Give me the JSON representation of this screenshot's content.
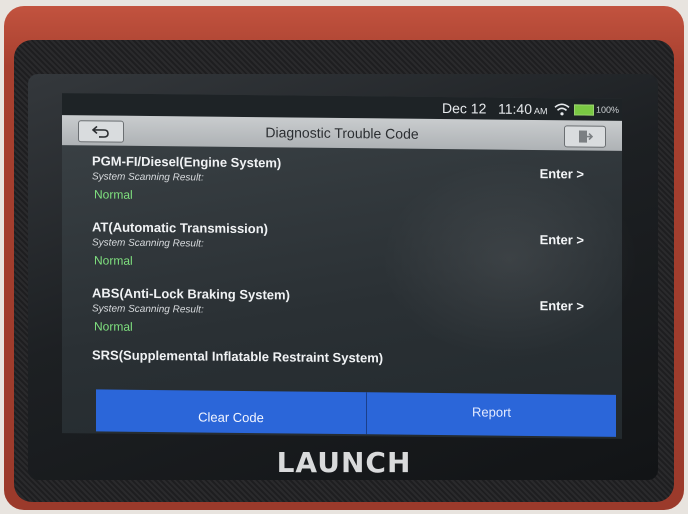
{
  "status": {
    "date": "Dec 12",
    "time": "11:40",
    "ampm": "AM",
    "battery": "100%"
  },
  "header": {
    "title": "Diagnostic Trouble Code"
  },
  "systems": [
    {
      "name": "PGM-FI/Diesel(Engine System)",
      "sub": "System Scanning Result:",
      "status": "Normal",
      "action": "Enter >"
    },
    {
      "name": "AT(Automatic Transmission)",
      "sub": "System Scanning Result:",
      "status": "Normal",
      "action": "Enter >"
    },
    {
      "name": "ABS(Anti-Lock Braking System)",
      "sub": "System Scanning Result:",
      "status": "Normal",
      "action": "Enter >"
    },
    {
      "name": "SRS(Supplemental Inflatable Restraint System)"
    }
  ],
  "footer": {
    "clear_label": "Clear Code",
    "report_label": "Report"
  },
  "brand": "LAUNCH",
  "colors": {
    "accent_blue": "#2b66d9",
    "status_green": "#7fe07f",
    "device_red": "#a8402f"
  }
}
